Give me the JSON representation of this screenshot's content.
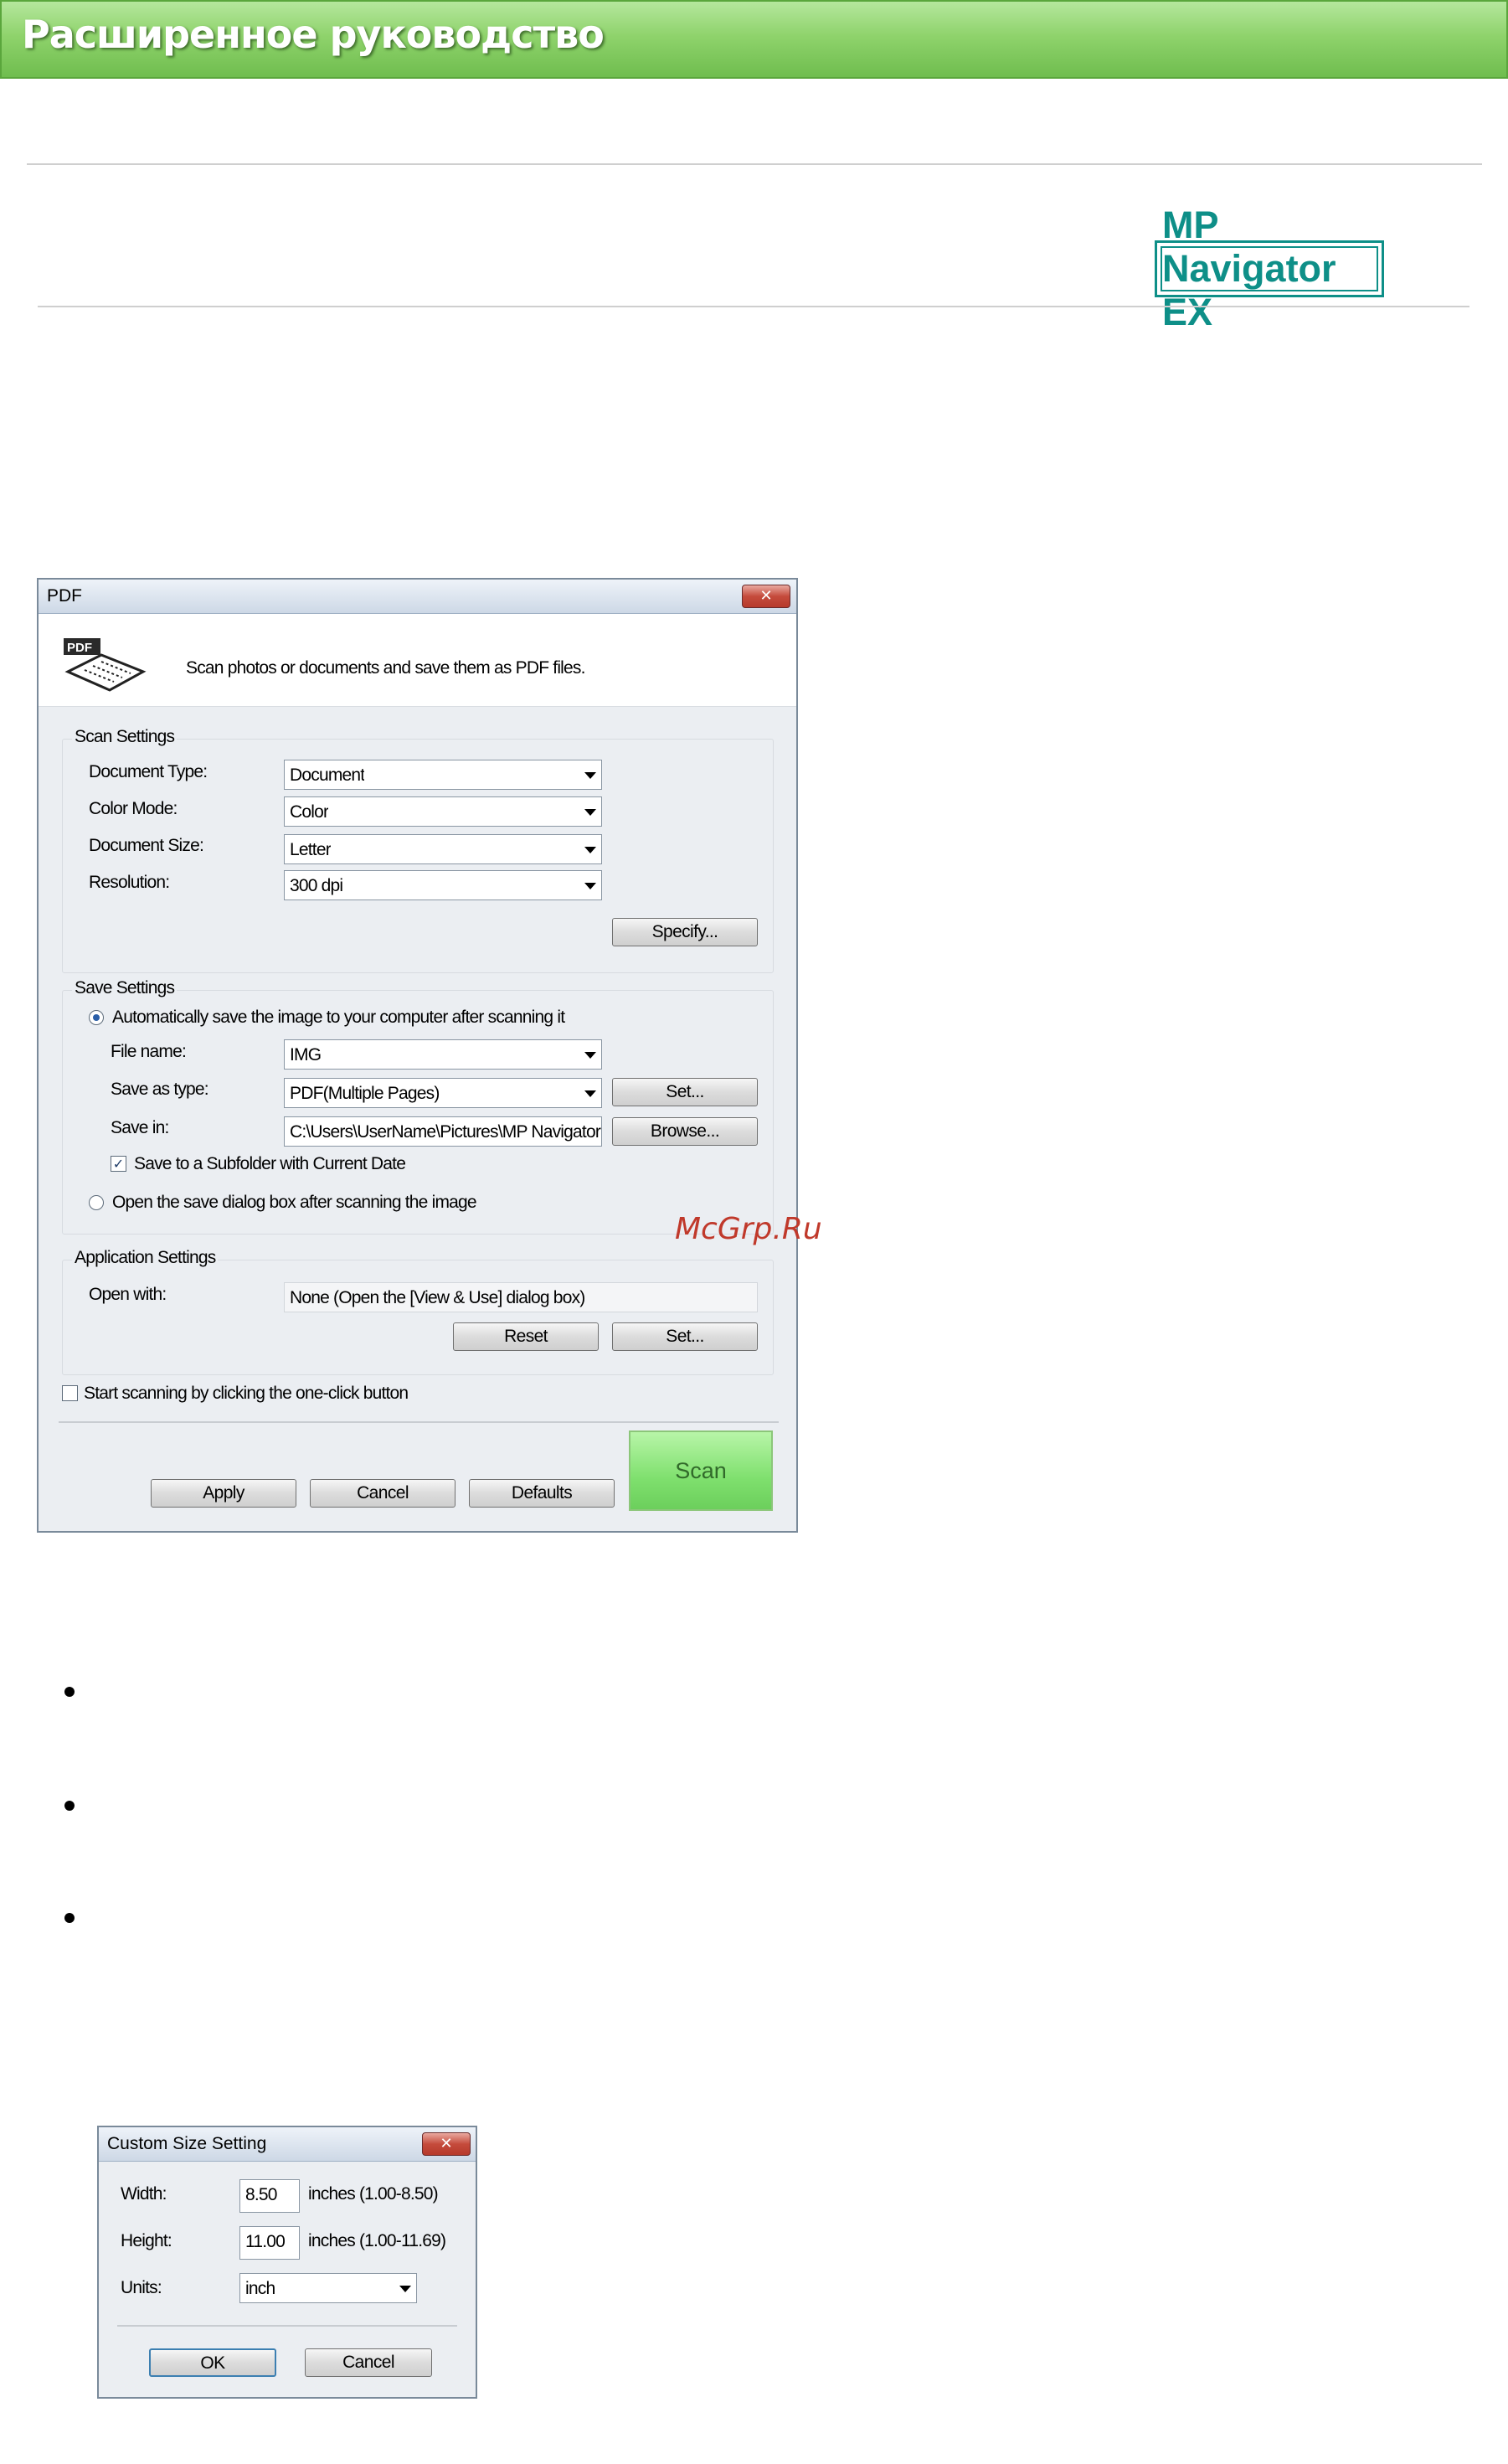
{
  "header": {
    "title": "Расширенное руководство",
    "logo_text": "MP Navigator EX"
  },
  "watermark": "McGrp.Ru",
  "pdf_dialog": {
    "title": "PDF",
    "close_glyph": "✕",
    "description": "Scan photos or documents and save them as PDF files.",
    "icon_label": "PDF",
    "scan_settings": {
      "group_label": "Scan Settings",
      "document_type_label": "Document Type:",
      "document_type_value": "Document",
      "color_mode_label": "Color Mode:",
      "color_mode_value": "Color",
      "document_size_label": "Document Size:",
      "document_size_value": "Letter",
      "resolution_label": "Resolution:",
      "resolution_value": "300 dpi",
      "specify_button": "Specify..."
    },
    "save_settings": {
      "group_label": "Save Settings",
      "auto_save_label": "Automatically save the image to your computer after scanning it",
      "file_name_label": "File name:",
      "file_name_value": "IMG",
      "save_as_type_label": "Save as type:",
      "save_as_type_value": "PDF(Multiple Pages)",
      "set_button": "Set...",
      "save_in_label": "Save in:",
      "save_in_value": "C:\\Users\\UserName\\Pictures\\MP Navigator",
      "browse_button": "Browse...",
      "subfolder_label": "Save to a Subfolder with Current Date",
      "subfolder_checked": "✓",
      "open_dialog_label": "Open the save dialog box after scanning the image"
    },
    "application_settings": {
      "group_label": "Application Settings",
      "open_with_label": "Open with:",
      "open_with_value": "None (Open the [View & Use] dialog box)",
      "reset_button": "Reset",
      "set_button": "Set..."
    },
    "one_click_label": "Start scanning by clicking the one-click button",
    "apply_button": "Apply",
    "cancel_button": "Cancel",
    "defaults_button": "Defaults",
    "scan_button": "Scan"
  },
  "custom_size_dialog": {
    "title": "Custom Size Setting",
    "close_glyph": "✕",
    "width_label": "Width:",
    "width_value": "8.50",
    "width_range": "inches (1.00-8.50)",
    "height_label": "Height:",
    "height_value": "11.00",
    "height_range": "inches (1.00-11.69)",
    "units_label": "Units:",
    "units_value": "inch",
    "ok_button": "OK",
    "cancel_button": "Cancel"
  }
}
